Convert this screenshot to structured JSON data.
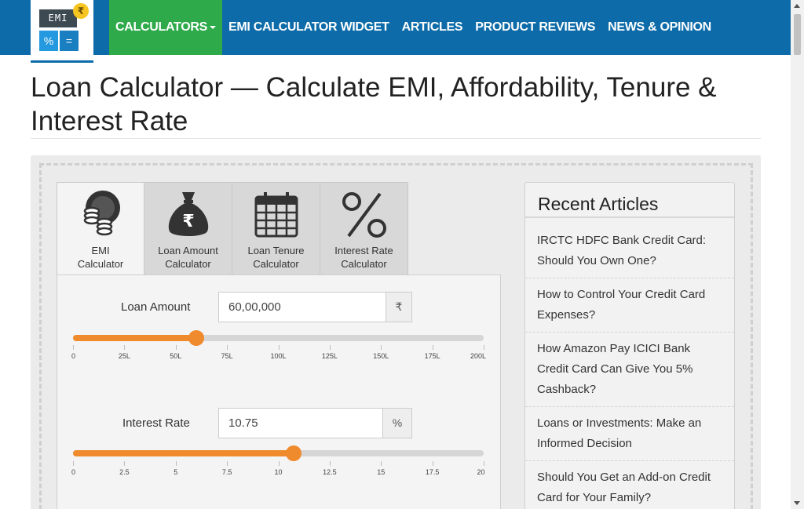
{
  "logo": {
    "screen_text": "EMI",
    "coin_symbol": "₹",
    "key_left": "%",
    "key_right": "="
  },
  "nav": {
    "items": [
      {
        "label": "CALCULATORS"
      },
      {
        "label": "EMI CALCULATOR WIDGET"
      },
      {
        "label": "ARTICLES"
      },
      {
        "label": "PRODUCT REVIEWS"
      },
      {
        "label": "NEWS & OPINION"
      }
    ]
  },
  "page": {
    "title": "Loan Calculator — Calculate EMI, Affordability, Tenure & Interest Rate"
  },
  "tabs": [
    {
      "line1": "EMI",
      "line2": "Calculator",
      "icon": "coins-icon"
    },
    {
      "line1": "Loan Amount",
      "line2": "Calculator",
      "icon": "money-bag-icon"
    },
    {
      "line1": "Loan Tenure",
      "line2": "Calculator",
      "icon": "calendar-icon"
    },
    {
      "line1": "Interest Rate",
      "line2": "Calculator",
      "icon": "percent-icon"
    }
  ],
  "loan_amount": {
    "label": "Loan Amount",
    "value": "60,00,000",
    "addon": "₹",
    "slider_fraction": 0.3,
    "ticks": [
      "0",
      "25L",
      "50L",
      "75L",
      "100L",
      "125L",
      "150L",
      "175L",
      "200L"
    ]
  },
  "interest_rate": {
    "label": "Interest Rate",
    "value": "10.75",
    "addon": "%",
    "slider_fraction": 0.5375,
    "ticks": [
      "0",
      "2.5",
      "5",
      "7.5",
      "10",
      "12.5",
      "15",
      "17.5",
      "20"
    ]
  },
  "sidebar": {
    "title": "Recent Articles",
    "articles": [
      "IRCTC HDFC Bank Credit Card: Should You Own One?",
      "How to Control Your Credit Card Expenses?",
      "How Amazon Pay ICICI Bank Credit Card Can Give You 5% Cashback?",
      "Loans or Investments: Make an Informed Decision",
      "Should You Get an Add-on Credit Card for Your Family?"
    ]
  },
  "colors": {
    "nav_bg": "#0c6ba8",
    "active_nav": "#2eaa4a",
    "slider_accent": "#ef8a2d"
  }
}
